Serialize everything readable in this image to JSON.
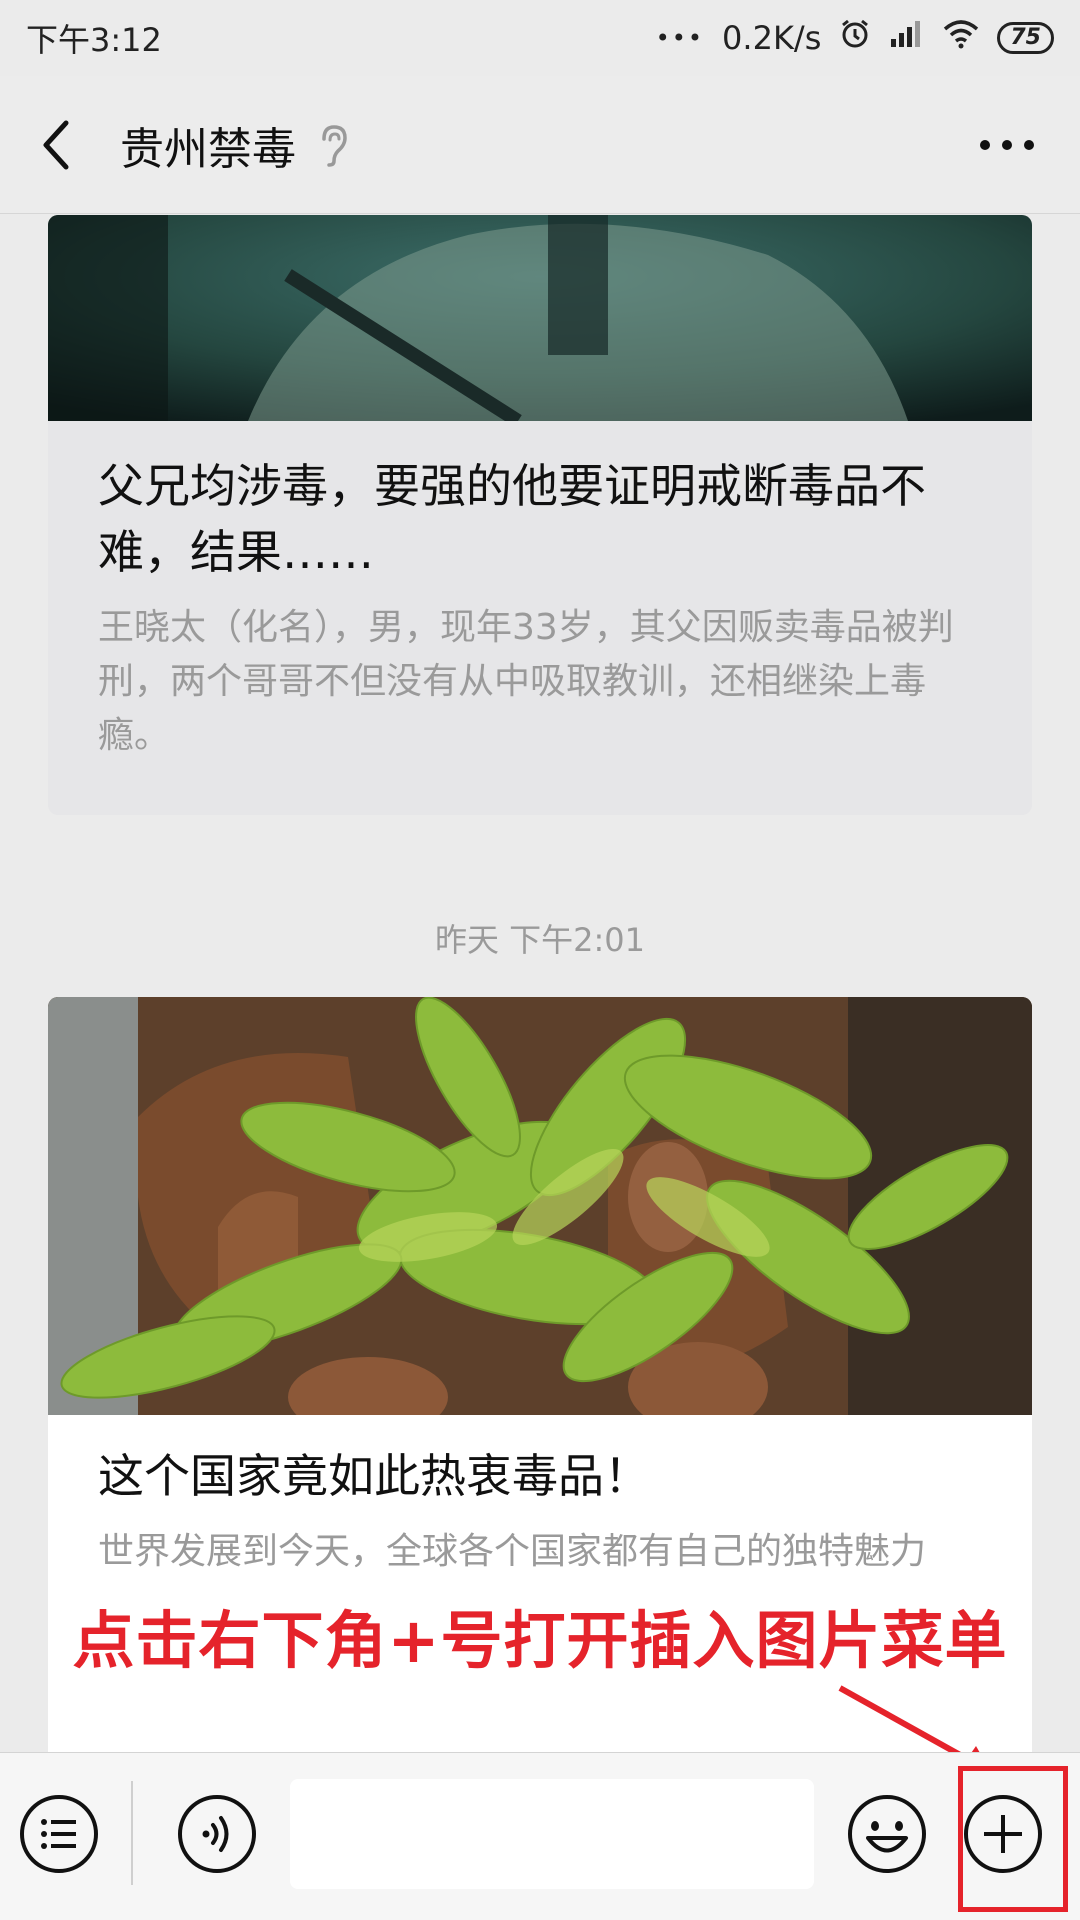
{
  "status_bar": {
    "time": "下午3:12",
    "dots": "•••",
    "network_speed": "0.2K/s",
    "battery": "75"
  },
  "nav": {
    "title": "贵州禁毒"
  },
  "messages": [
    {
      "title": "父兄均涉毒，要强的他要证明戒断毒品不难，结果……",
      "summary": "王晓太（化名），男，现年33岁，其父因贩卖毒品被判刑，两个哥哥不但没有从中吸取教训，还相继染上毒瘾。"
    },
    {
      "title": "这个国家竟如此热衷毒品！",
      "summary": "世界发展到今天，全球各个国家都有自己的独特魅力"
    }
  ],
  "timestamp": "昨天 下午2:01",
  "overlay": {
    "instruction": "点击右下角+号打开插入图片菜单",
    "color": "#e5232b"
  },
  "input": {
    "value": ""
  },
  "icons": {
    "back": "chevron-left-icon",
    "ear": "ear-icon",
    "more": "more-horizontal-icon",
    "menu": "list-menu-icon",
    "voice": "voice-icon",
    "emoji": "emoji-icon",
    "plus": "plus-circle-icon",
    "alarm": "alarm-icon",
    "signal": "signal-icon",
    "wifi": "wifi-icon"
  }
}
